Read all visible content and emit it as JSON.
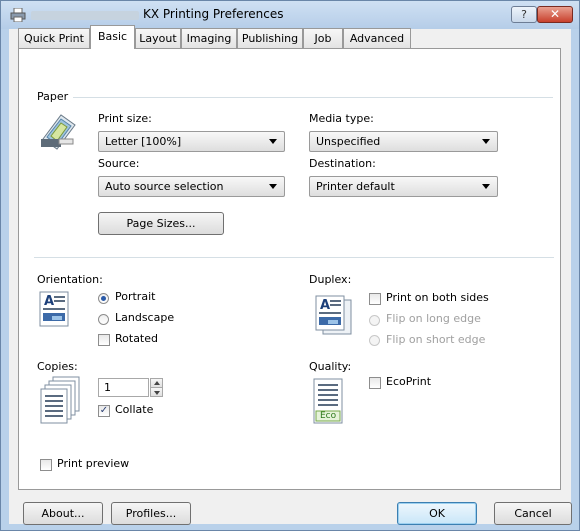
{
  "window": {
    "title": "KX Printing Preferences",
    "help_label": "?",
    "close_label": "✕"
  },
  "tabs": [
    {
      "label": "Quick Print"
    },
    {
      "label": "Basic"
    },
    {
      "label": "Layout"
    },
    {
      "label": "Imaging"
    },
    {
      "label": "Publishing"
    },
    {
      "label": "Job"
    },
    {
      "label": "Advanced"
    }
  ],
  "paper": {
    "group_label": "Paper",
    "print_size_label": "Print size:",
    "print_size_value": "Letter [100%]",
    "media_type_label": "Media type:",
    "media_type_value": "Unspecified",
    "source_label": "Source:",
    "source_value": "Auto source selection",
    "destination_label": "Destination:",
    "destination_value": "Printer default",
    "page_sizes_button": "Page Sizes..."
  },
  "orientation": {
    "group_label": "Orientation:",
    "portrait": "Portrait",
    "landscape": "Landscape",
    "rotated": "Rotated"
  },
  "duplex": {
    "group_label": "Duplex:",
    "print_both_sides": "Print on both sides",
    "flip_long": "Flip on long edge",
    "flip_short": "Flip on short edge"
  },
  "copies": {
    "group_label": "Copies:",
    "value": "1",
    "collate": "Collate"
  },
  "quality": {
    "group_label": "Quality:",
    "ecoprint": "EcoPrint",
    "eco_icon_text": "Eco"
  },
  "print_preview": "Print preview",
  "footer": {
    "about": "About...",
    "profiles": "Profiles...",
    "ok": "OK",
    "cancel": "Cancel"
  },
  "check_mark": "✓"
}
